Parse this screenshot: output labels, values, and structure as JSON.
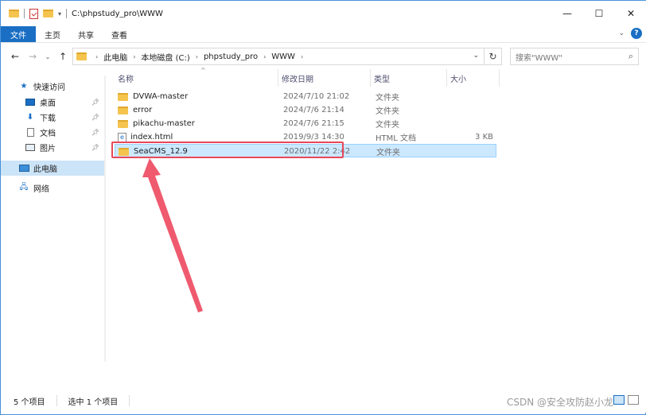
{
  "window": {
    "title": "C:\\phpstudy_pro\\WWW"
  },
  "ribbon": {
    "tabs": [
      "文件",
      "主页",
      "共享",
      "查看"
    ]
  },
  "address": {
    "crumbs": [
      "此电脑",
      "本地磁盘 (C:)",
      "phpstudy_pro",
      "WWW"
    ],
    "search_placeholder": "搜索\"WWW\""
  },
  "navpane": {
    "quick_access": "快速访问",
    "items": [
      {
        "label": "桌面",
        "icon": "desktop-icon"
      },
      {
        "label": "下载",
        "icon": "download-icon"
      },
      {
        "label": "文档",
        "icon": "document-icon"
      },
      {
        "label": "图片",
        "icon": "pictures-icon"
      }
    ],
    "this_pc": "此电脑",
    "network": "网络"
  },
  "columns": {
    "name": "名称",
    "date": "修改日期",
    "type": "类型",
    "size": "大小"
  },
  "files": [
    {
      "name": "DVWA-master",
      "date": "2024/7/10 21:02",
      "type": "文件夹",
      "size": "",
      "icon": "folder-icon"
    },
    {
      "name": "error",
      "date": "2024/7/6 21:14",
      "type": "文件夹",
      "size": "",
      "icon": "folder-icon"
    },
    {
      "name": "pikachu-master",
      "date": "2024/7/6 21:15",
      "type": "文件夹",
      "size": "",
      "icon": "folder-icon"
    },
    {
      "name": "index.html",
      "date": "2019/9/3 14:30",
      "type": "HTML 文档",
      "size": "3 KB",
      "icon": "html-file-icon"
    },
    {
      "name": "SeaCMS_12.9",
      "date": "2020/11/22 2:42",
      "type": "文件夹",
      "size": "",
      "icon": "folder-icon",
      "selected": true
    }
  ],
  "status": {
    "count": "5 个项目",
    "selected": "选中 1 个项目"
  },
  "watermark": "CSDN @安全攻防赵小龙",
  "colors": {
    "accent": "#1a6fc4",
    "selection": "#cce8ff",
    "annotation": "#e8475b"
  }
}
